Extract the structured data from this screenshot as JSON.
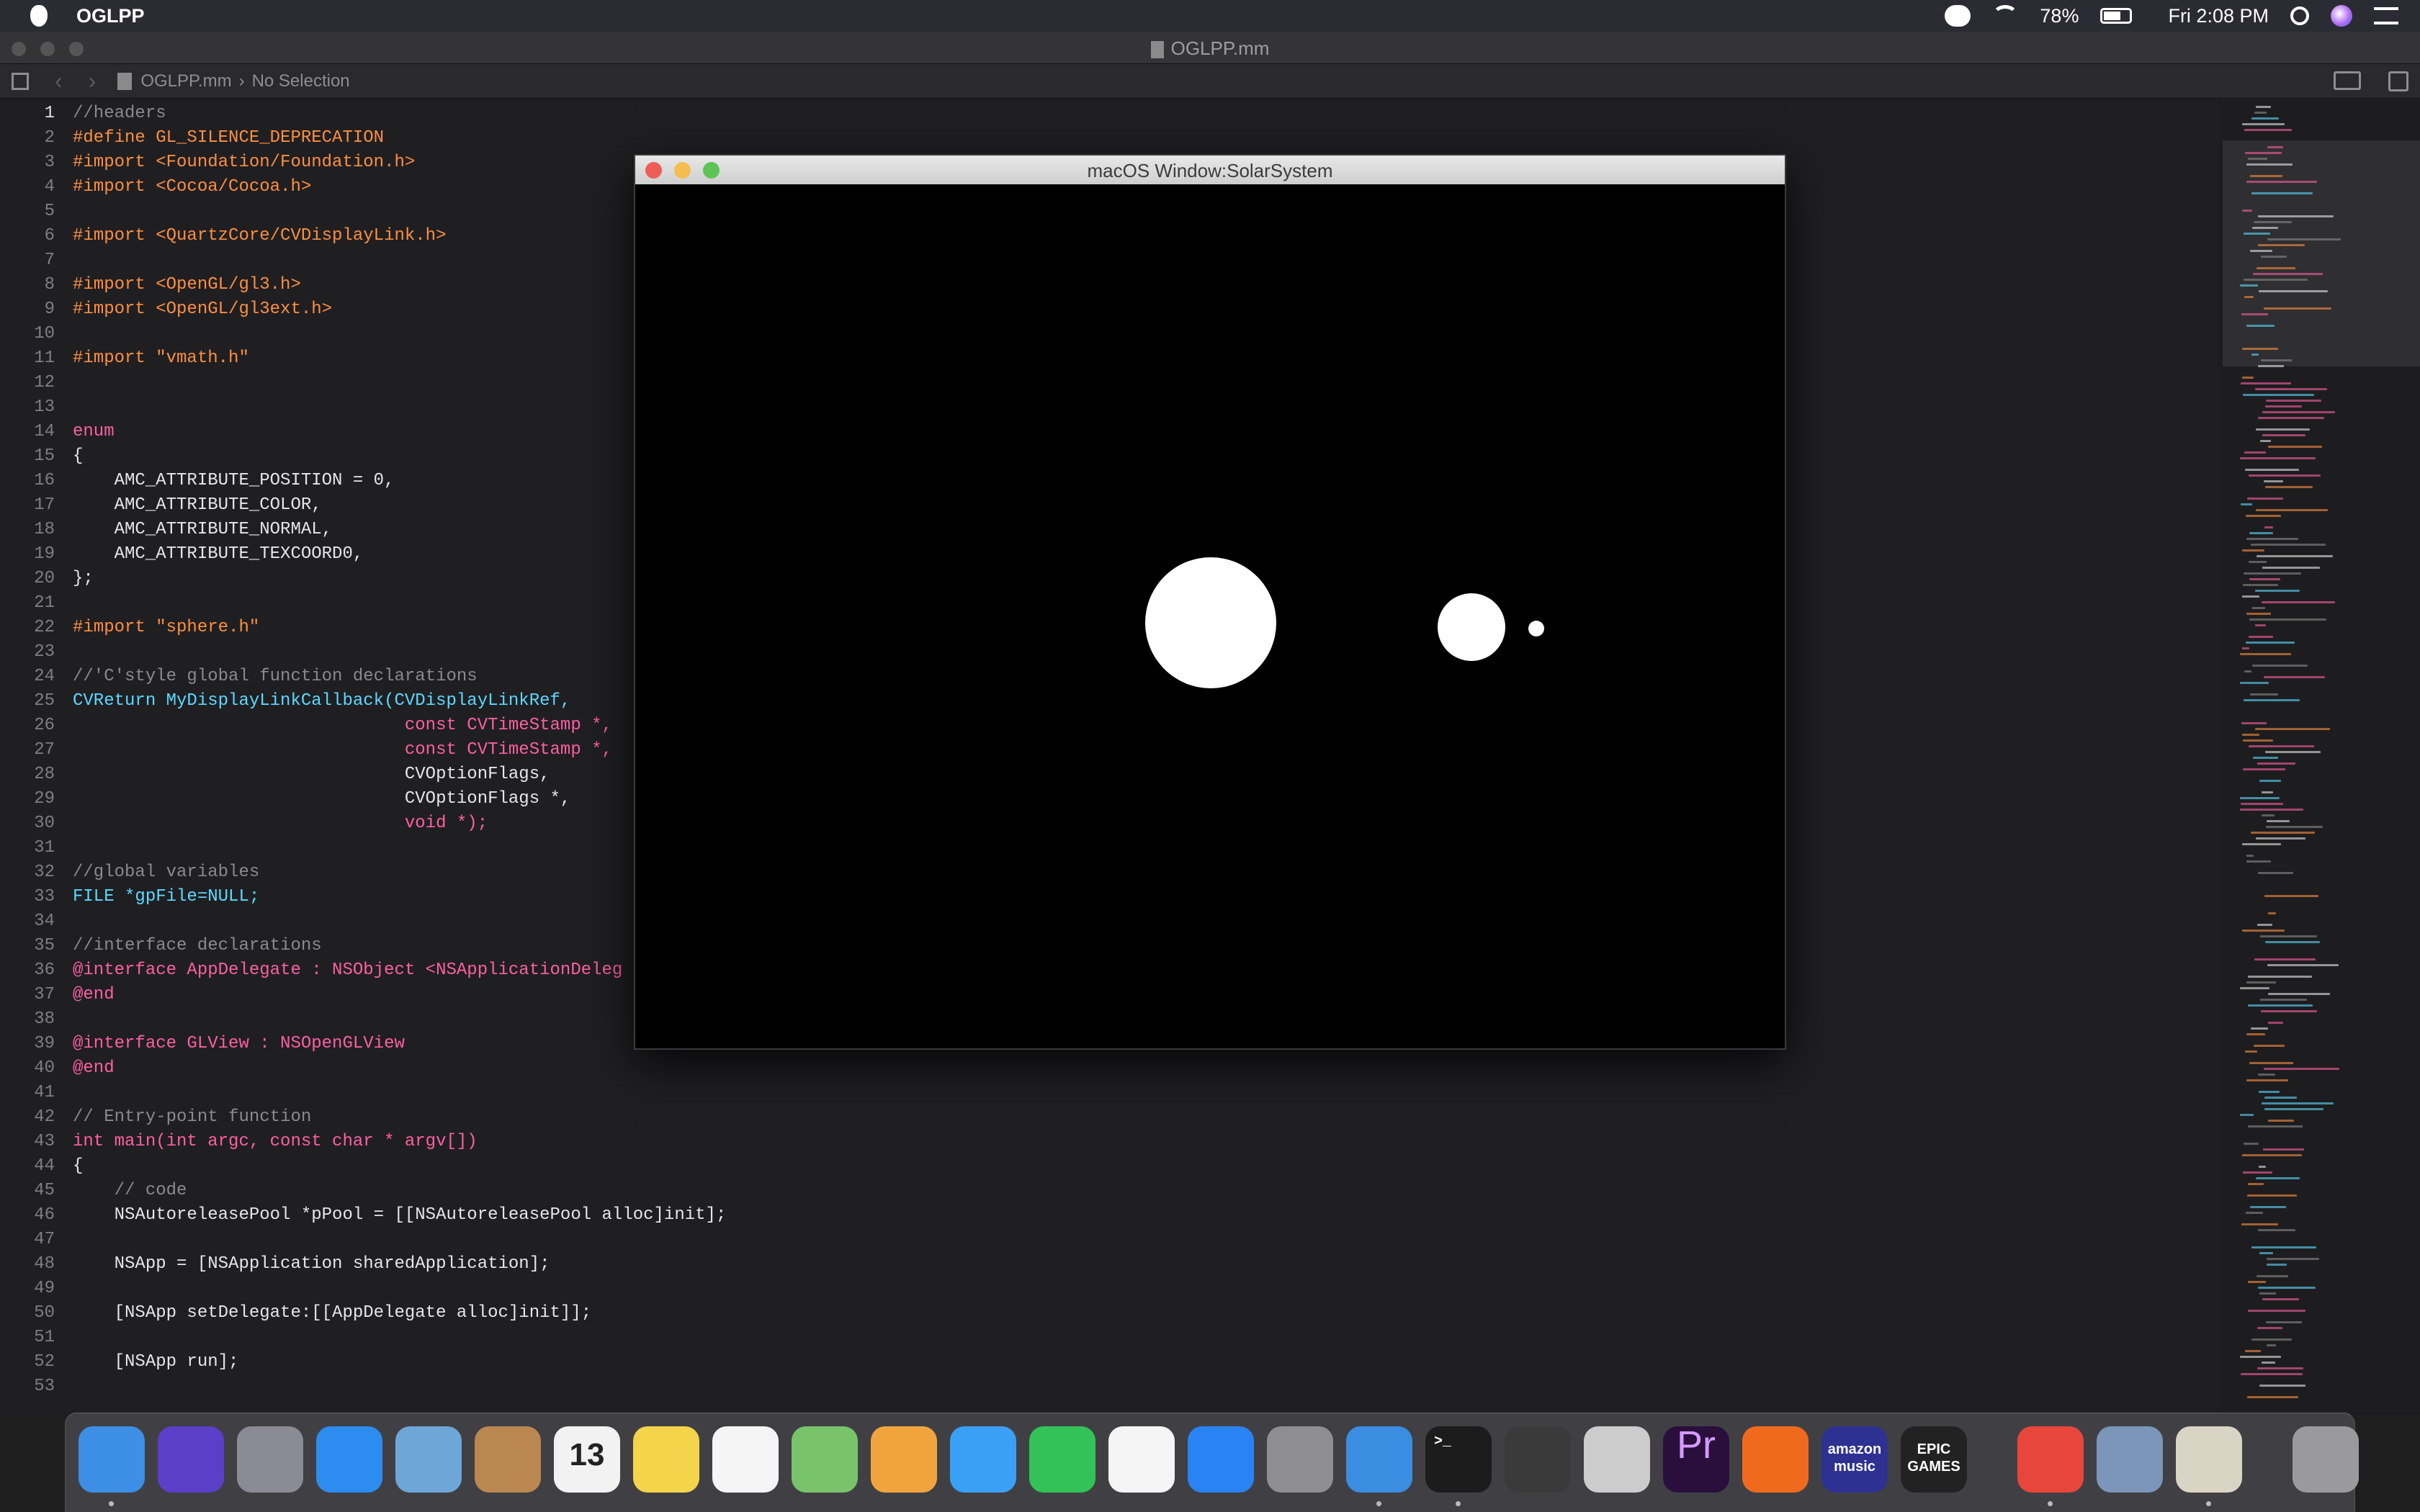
{
  "menubar": {
    "app_name": "OGLPP",
    "battery": "78%",
    "clock": "Fri 2:08 PM"
  },
  "window": {
    "doc_title": "OGLPP.mm",
    "breadcrumb_file": "OGLPP.mm",
    "breadcrumb_selection": "No Selection"
  },
  "gl_window": {
    "title": "macOS Window:SolarSystem"
  },
  "colors": {
    "comment": "#8a8a8a",
    "preprocessor": "#fd8f3f",
    "keyword": "#fc5fa3",
    "type": "#5dd8ff",
    "plain": "#e6e6e6",
    "number": "#d0bf69"
  },
  "code": [
    {
      "n": "1",
      "t": "//headers",
      "c": "comment"
    },
    {
      "n": "2",
      "t": "#define GL_SILENCE_DEPRECATION",
      "c": "preprocessor"
    },
    {
      "n": "3",
      "t": "#import <Foundation/Foundation.h>",
      "c": "preprocessor"
    },
    {
      "n": "4",
      "t": "#import <Cocoa/Cocoa.h>",
      "c": "preprocessor"
    },
    {
      "n": "5",
      "t": "",
      "c": "plain"
    },
    {
      "n": "6",
      "t": "#import <QuartzCore/CVDisplayLink.h>",
      "c": "preprocessor"
    },
    {
      "n": "7",
      "t": "",
      "c": "plain"
    },
    {
      "n": "8",
      "t": "#import <OpenGL/gl3.h>",
      "c": "preprocessor"
    },
    {
      "n": "9",
      "t": "#import <OpenGL/gl3ext.h>",
      "c": "preprocessor"
    },
    {
      "n": "10",
      "t": "",
      "c": "plain"
    },
    {
      "n": "11",
      "t": "#import \"vmath.h\"",
      "c": "preprocessor"
    },
    {
      "n": "12",
      "t": "",
      "c": "plain"
    },
    {
      "n": "13",
      "t": "",
      "c": "plain"
    },
    {
      "n": "14",
      "t": "enum",
      "c": "keyword"
    },
    {
      "n": "15",
      "t": "{",
      "c": "plain"
    },
    {
      "n": "16",
      "t": "    AMC_ATTRIBUTE_POSITION = 0,",
      "c": "plain"
    },
    {
      "n": "17",
      "t": "    AMC_ATTRIBUTE_COLOR,",
      "c": "plain"
    },
    {
      "n": "18",
      "t": "    AMC_ATTRIBUTE_NORMAL,",
      "c": "plain"
    },
    {
      "n": "19",
      "t": "    AMC_ATTRIBUTE_TEXCOORD0,",
      "c": "plain"
    },
    {
      "n": "20",
      "t": "};",
      "c": "plain"
    },
    {
      "n": "21",
      "t": "",
      "c": "plain"
    },
    {
      "n": "22",
      "t": "#import \"sphere.h\"",
      "c": "preprocessor"
    },
    {
      "n": "23",
      "t": "",
      "c": "plain"
    },
    {
      "n": "24",
      "t": "//'C'style global function declarations",
      "c": "comment"
    },
    {
      "n": "25",
      "t": "CVReturn MyDisplayLinkCallback(CVDisplayLinkRef,",
      "c": "type"
    },
    {
      "n": "26",
      "t": "                                const CVTimeStamp *,",
      "c": "keyword"
    },
    {
      "n": "27",
      "t": "                                const CVTimeStamp *,",
      "c": "keyword"
    },
    {
      "n": "28",
      "t": "                                CVOptionFlags,",
      "c": "plain"
    },
    {
      "n": "29",
      "t": "                                CVOptionFlags *,",
      "c": "plain"
    },
    {
      "n": "30",
      "t": "                                void *);",
      "c": "keyword"
    },
    {
      "n": "31",
      "t": "",
      "c": "plain"
    },
    {
      "n": "32",
      "t": "//global variables",
      "c": "comment"
    },
    {
      "n": "33",
      "t": "FILE *gpFile=NULL;",
      "c": "type"
    },
    {
      "n": "34",
      "t": "",
      "c": "plain"
    },
    {
      "n": "35",
      "t": "//interface declarations",
      "c": "comment"
    },
    {
      "n": "36",
      "t": "@interface AppDelegate : NSObject <NSApplicationDeleg",
      "c": "keyword"
    },
    {
      "n": "37",
      "t": "@end",
      "c": "keyword"
    },
    {
      "n": "38",
      "t": "",
      "c": "plain"
    },
    {
      "n": "39",
      "t": "@interface GLView : NSOpenGLView",
      "c": "keyword"
    },
    {
      "n": "40",
      "t": "@end",
      "c": "keyword"
    },
    {
      "n": "41",
      "t": "",
      "c": "plain"
    },
    {
      "n": "42",
      "t": "// Entry-point function",
      "c": "comment"
    },
    {
      "n": "43",
      "t": "int main(int argc, const char * argv[])",
      "c": "keyword"
    },
    {
      "n": "44",
      "t": "{",
      "c": "plain"
    },
    {
      "n": "45",
      "t": "    // code",
      "c": "comment"
    },
    {
      "n": "46",
      "t": "    NSAutoreleasePool *pPool = [[NSAutoreleasePool alloc]init];",
      "c": "plain"
    },
    {
      "n": "47",
      "t": "",
      "c": "plain"
    },
    {
      "n": "48",
      "t": "    NSApp = [NSApplication sharedApplication];",
      "c": "plain"
    },
    {
      "n": "49",
      "t": "",
      "c": "plain"
    },
    {
      "n": "50",
      "t": "    [NSApp setDelegate:[[AppDelegate alloc]init]];",
      "c": "plain"
    },
    {
      "n": "51",
      "t": "",
      "c": "plain"
    },
    {
      "n": "52",
      "t": "    [NSApp run];",
      "c": "plain"
    },
    {
      "n": "53",
      "t": "",
      "c": "plain"
    }
  ],
  "dock": [
    {
      "name": "finder-icon",
      "label": "",
      "color": "#3d8fe6"
    },
    {
      "name": "siri-icon",
      "label": "",
      "color": "#5b3fc9"
    },
    {
      "name": "launchpad-icon",
      "label": "",
      "color": "#8b8b95"
    },
    {
      "name": "safari-icon",
      "label": "",
      "color": "#2c8cf0"
    },
    {
      "name": "mail-icon",
      "label": "",
      "color": "#6fa6d8"
    },
    {
      "name": "contacts-icon",
      "label": "",
      "color": "#b9874f"
    },
    {
      "name": "calendar-icon",
      "label": "13",
      "color": "#f2f2f2"
    },
    {
      "name": "notes-icon",
      "label": "",
      "color": "#f4d44a"
    },
    {
      "name": "reminders-icon",
      "label": "",
      "color": "#f5f5f5"
    },
    {
      "name": "maps-icon",
      "label": "",
      "color": "#79c36b"
    },
    {
      "name": "photos-icon",
      "label": "",
      "color": "#f2a43c"
    },
    {
      "name": "messages-icon",
      "label": "",
      "color": "#3aa0f5"
    },
    {
      "name": "facetime-icon",
      "label": "",
      "color": "#33c258"
    },
    {
      "name": "music-icon",
      "label": "",
      "color": "#f5f5f5"
    },
    {
      "name": "app-store-icon",
      "label": "",
      "color": "#2a83f2"
    },
    {
      "name": "system-preferences-icon",
      "label": "",
      "color": "#8e8e93"
    },
    {
      "name": "xcode-icon",
      "label": "",
      "color": "#3a8de0"
    },
    {
      "name": "terminal-icon",
      "label": ">_",
      "color": "#1c1c1c"
    },
    {
      "name": "final-cut-icon",
      "label": "",
      "color": "#3a3a3a"
    },
    {
      "name": "disk-utility-icon",
      "label": "",
      "color": "#cccccc"
    },
    {
      "name": "premiere-icon",
      "label": "Pr",
      "color": "#2a0f3d"
    },
    {
      "name": "firefox-icon",
      "label": "",
      "color": "#f06a1d"
    },
    {
      "name": "amazon-music-icon",
      "label": "amazon music",
      "color": "#2e3192"
    },
    {
      "name": "epic-games-icon",
      "label": "EPIC GAMES",
      "color": "#222222"
    },
    {
      "name": "anydesk-icon",
      "label": "",
      "color": "#e8463a"
    },
    {
      "name": "preview-icon",
      "label": "",
      "color": "#7b96b9"
    },
    {
      "name": "instruments-icon",
      "label": "",
      "color": "#d9d4c4"
    },
    {
      "name": "trash-icon",
      "label": "",
      "color": "#9a9a9e"
    }
  ]
}
